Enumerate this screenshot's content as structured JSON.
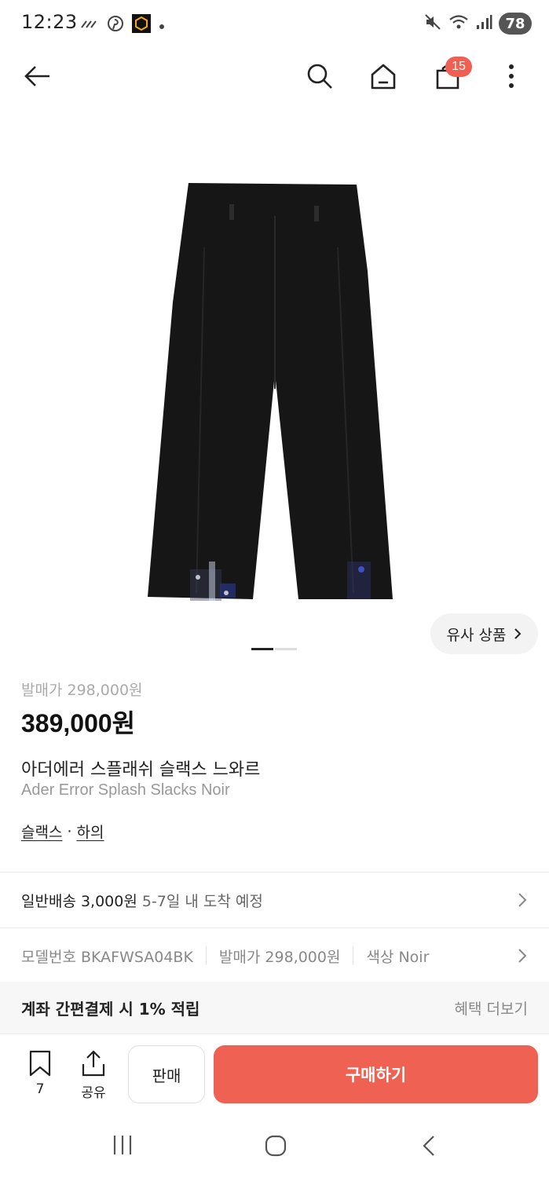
{
  "status_bar": {
    "time": "12:23",
    "battery": "78",
    "icons": [
      "cast-lines-icon",
      "pinterest-icon",
      "hexagon-app-icon",
      "dot-icon",
      "mute-icon",
      "wifi-icon",
      "signal-icon"
    ]
  },
  "app_bar": {
    "back_icon": "arrow-left-icon",
    "search_icon": "search-icon",
    "home_icon": "home-icon",
    "cart_icon": "shopping-bag-icon",
    "cart_count": "15",
    "more_icon": "more-vertical-icon"
  },
  "product": {
    "image_count": 2,
    "image_current": 1,
    "similar_label": "유사 상품",
    "release_price": "발매가 298,000원",
    "price": "389,000원",
    "name_ko": "아더에러 스플래쉬 슬랙스 느와르",
    "name_en": "Ader Error Splash Slacks Noir",
    "categories": [
      "슬랙스",
      "하의"
    ],
    "category_separator": "·"
  },
  "delivery": {
    "method": "일반배송 3,000원",
    "eta": "5-7일 내 도착 예정"
  },
  "specs": {
    "model": "모델번호 BKAFWSA04BK",
    "release": "발매가 298,000원",
    "color": "색상 Noir"
  },
  "benefit": {
    "title": "계좌 간편결제 시 1% 적립",
    "more": "혜택 더보기"
  },
  "actions": {
    "bookmark_count": "7",
    "share_label": "공유",
    "sell_label": "판매",
    "buy_label": "구매하기"
  },
  "colors": {
    "accent": "#ef6253",
    "badge": "#ef5f52"
  }
}
